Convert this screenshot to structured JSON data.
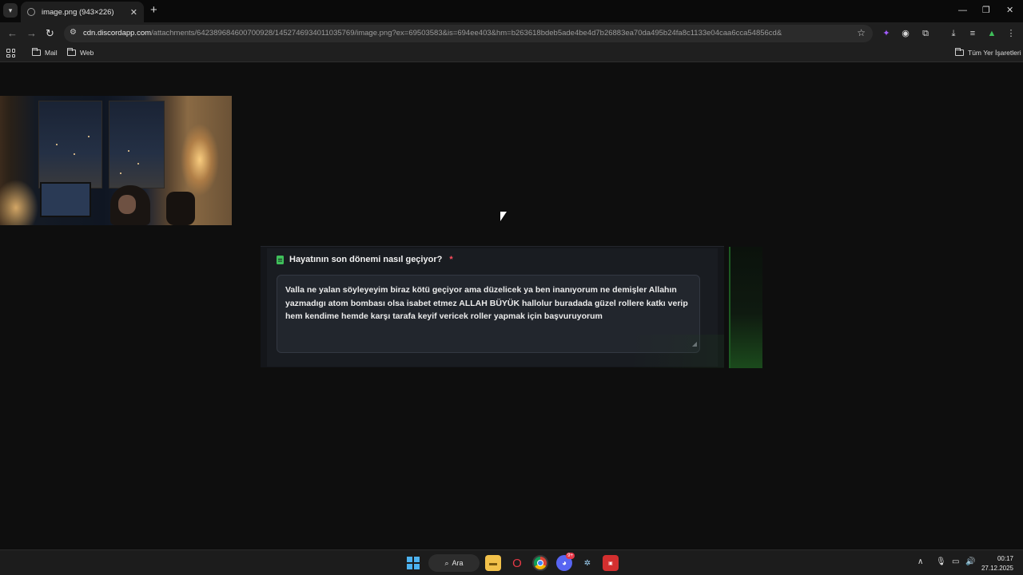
{
  "browser": {
    "tab_title": "image.png (943×226)",
    "new_tab_symbol": "+",
    "url_host": "cdn.discordapp.com",
    "url_path": "/attachments/642389684600700928/1452746934011035769/image.png?ex=69503583&is=694ee403&hm=b263618bdeb5ade4be4d7b26883ea70da495b24fa8c1133e04caa6cca54856cd&",
    "bookmarks": [
      {
        "label": "Mail"
      },
      {
        "label": "Web"
      }
    ],
    "all_bookmarks_label": "Tüm Yer İşaretleri"
  },
  "form": {
    "question": "Hayatının son dönemi nasıl geçiyor?",
    "required_marker": "*",
    "answer": "Valla ne yalan söyleyeyim biraz kötü geçiyor ama düzelicek ya ben inanıyorum ne demişler Allahın yazmadıgı atom bombası olsa isabet etmez ALLAH BÜYÜK hallolur buradada güzel rollere katkı verip hem kendime hemde karşı tarafa keyif vericek roller yapmak için başvuruyorum",
    "accent_color": "#3fbf5a"
  },
  "taskbar": {
    "search_label": "Ara",
    "discord_badge": "9+",
    "time": "00:17",
    "date": "27.12.2025"
  }
}
